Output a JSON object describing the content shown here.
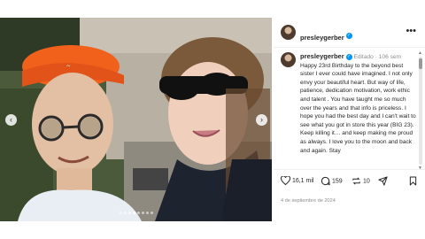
{
  "post": {
    "username": "presleygerber",
    "caption": {
      "username": "presleygerber",
      "edited": "Editado",
      "age": "106 sem",
      "text": "Happy 23rd Birthday to the beyond best sister I ever could have imagined. I not only envy your beautiful heart. But way of life, patience, dedication motivation, work  ethic and talent . You have taught me so much over the years and that info is priceless. I hope you had the best day and I can't wait to see what you got in store this year (BIG 23). Keep killing it… and keep making me proud as always. I love you to the moon and back and again. Stay"
    },
    "stats": {
      "likes": "16,1 mil",
      "comments": "159",
      "reposts": "10"
    },
    "date": "4 de septiembre de 2024"
  },
  "colors": {
    "verified": "#0095f6",
    "text": "#262626",
    "muted": "#8e8e8e"
  },
  "icons": [
    "verified-badge-icon",
    "more-options-icon",
    "heart-icon",
    "comment-icon",
    "repost-icon",
    "share-icon",
    "bookmark-icon",
    "chevron-left-icon",
    "chevron-right-icon"
  ]
}
